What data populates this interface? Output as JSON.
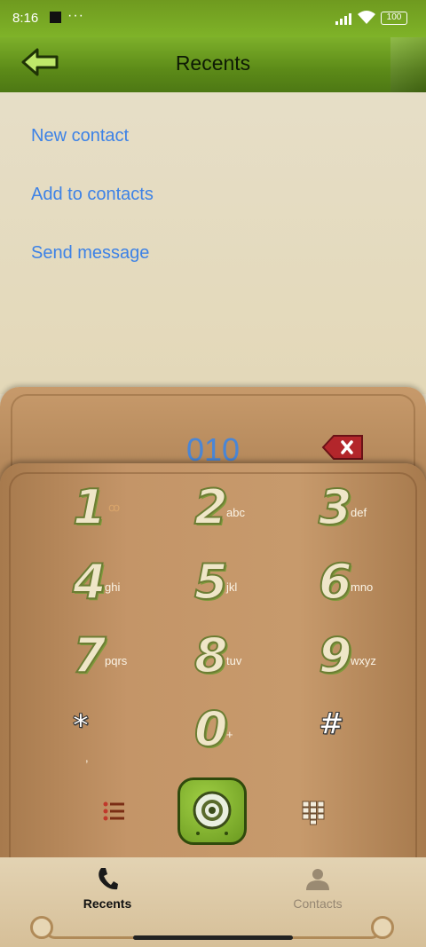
{
  "status": {
    "time": "8:16",
    "dots": "···",
    "battery": "100"
  },
  "header": {
    "title": "Recents"
  },
  "menu": {
    "items": [
      "New contact",
      "Add to contacts",
      "Send message"
    ]
  },
  "dialer": {
    "number": "010",
    "keys": [
      {
        "digit": "1",
        "letters": "ꝏ"
      },
      {
        "digit": "2",
        "letters": "abc"
      },
      {
        "digit": "3",
        "letters": "def"
      },
      {
        "digit": "4",
        "letters": "ghi"
      },
      {
        "digit": "5",
        "letters": "jkl"
      },
      {
        "digit": "6",
        "letters": "mno"
      },
      {
        "digit": "7",
        "letters": "pqrs"
      },
      {
        "digit": "8",
        "letters": "tuv"
      },
      {
        "digit": "9",
        "letters": "wxyz"
      },
      {
        "digit": "*",
        "letters": ","
      },
      {
        "digit": "0",
        "letters": "+"
      },
      {
        "digit": "#",
        "letters": ""
      }
    ]
  },
  "bottom_nav": {
    "tabs": [
      {
        "label": "Recents",
        "active": true
      },
      {
        "label": "Contacts",
        "active": false
      }
    ]
  },
  "colors": {
    "accent": "#3d82e6",
    "header_green": "#6b9a20",
    "wood": "#c49568"
  }
}
